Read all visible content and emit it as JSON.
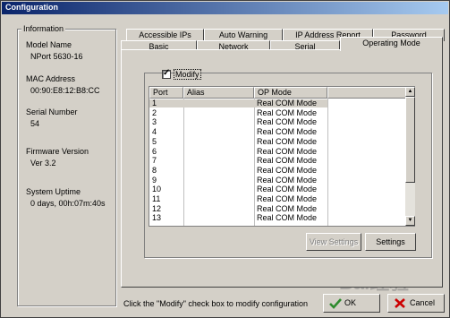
{
  "window": {
    "title": "Configuration"
  },
  "info": {
    "legend": "Information",
    "model_name_label": "Model Name",
    "model_name_value": "NPort 5630-16",
    "mac_label": "MAC Address",
    "mac_value": "00:90:E8:12:B8:CC",
    "serial_label": "Serial Number",
    "serial_value": "54",
    "firmware_label": "Firmware Version",
    "firmware_value": "Ver 3.2",
    "uptime_label": "System Uptime",
    "uptime_value": "0 days, 00h:07m:40s"
  },
  "tabs": {
    "back_row": [
      "Accessible IPs",
      "Auto Warning",
      "IP Address Report",
      "Password"
    ],
    "front_row": [
      "Basic",
      "Network",
      "Serial",
      "Operating Mode"
    ],
    "active": "Operating Mode"
  },
  "modify": {
    "label": "Modify",
    "checked": true
  },
  "ports_table": {
    "columns": [
      "Port",
      "Alias",
      "OP Mode"
    ],
    "rows": [
      {
        "port": "1",
        "alias": "",
        "mode": "Real COM Mode"
      },
      {
        "port": "2",
        "alias": "",
        "mode": "Real COM Mode"
      },
      {
        "port": "3",
        "alias": "",
        "mode": "Real COM Mode"
      },
      {
        "port": "4",
        "alias": "",
        "mode": "Real COM Mode"
      },
      {
        "port": "5",
        "alias": "",
        "mode": "Real COM Mode"
      },
      {
        "port": "6",
        "alias": "",
        "mode": "Real COM Mode"
      },
      {
        "port": "7",
        "alias": "",
        "mode": "Real COM Mode"
      },
      {
        "port": "8",
        "alias": "",
        "mode": "Real COM Mode"
      },
      {
        "port": "9",
        "alias": "",
        "mode": "Real COM Mode"
      },
      {
        "port": "10",
        "alias": "",
        "mode": "Real COM Mode"
      },
      {
        "port": "11",
        "alias": "",
        "mode": "Real COM Mode"
      },
      {
        "port": "12",
        "alias": "",
        "mode": "Real COM Mode"
      },
      {
        "port": "13",
        "alias": "",
        "mode": "Real COM Mode"
      }
    ]
  },
  "buttons": {
    "view_settings": "View Settings",
    "settings": "Settings",
    "ok": "OK",
    "cancel": "Cancel"
  },
  "status_text": "Click the \"Modify\" check box to modify configuration",
  "watermark": "Bai经验",
  "colors": {
    "titlebar": "#0a246a",
    "face": "#d4d0c8",
    "ok_check": "#2e8b2e",
    "cancel_x": "#cc0000"
  }
}
